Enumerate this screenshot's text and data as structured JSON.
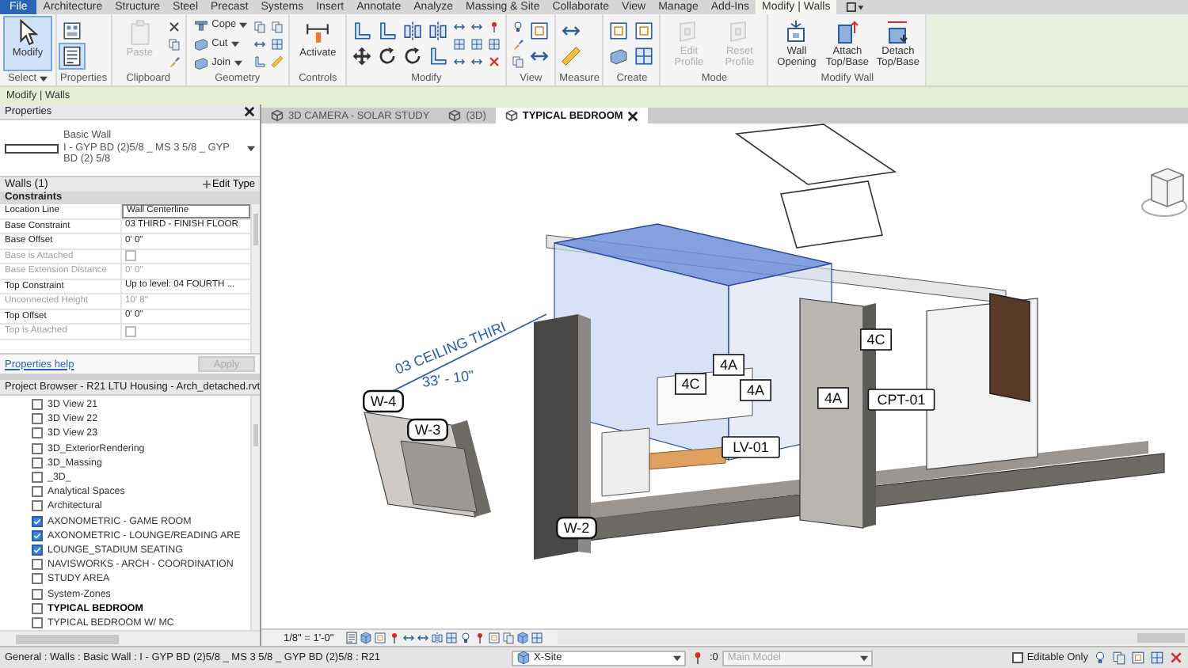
{
  "menu_tabs": [
    {
      "label": "File",
      "kind": "file",
      "selected": false
    },
    {
      "label": "Architecture",
      "kind": "tab",
      "selected": false
    },
    {
      "label": "Structure",
      "kind": "tab",
      "selected": false
    },
    {
      "label": "Steel",
      "kind": "tab",
      "selected": false
    },
    {
      "label": "Precast",
      "kind": "tab",
      "selected": false
    },
    {
      "label": "Systems",
      "kind": "tab",
      "selected": false
    },
    {
      "label": "Insert",
      "kind": "tab",
      "selected": false
    },
    {
      "label": "Annotate",
      "kind": "tab",
      "selected": false
    },
    {
      "label": "Analyze",
      "kind": "tab",
      "selected": false
    },
    {
      "label": "Massing & Site",
      "kind": "tab",
      "selected": false
    },
    {
      "label": "Collaborate",
      "kind": "tab",
      "selected": false
    },
    {
      "label": "View",
      "kind": "tab",
      "selected": false
    },
    {
      "label": "Manage",
      "kind": "tab",
      "selected": false
    },
    {
      "label": "Add-Ins",
      "kind": "tab",
      "selected": false
    },
    {
      "label": "Modify | Walls",
      "kind": "tab",
      "selected": true
    }
  ],
  "ribbon_panels": [
    {
      "title": "Select",
      "menu": true,
      "columns": [
        [
          {
            "kind": "large",
            "label": "Modify",
            "selected": true,
            "disabled": false
          }
        ]
      ]
    },
    {
      "title": "Properties",
      "menu": false,
      "columns": [
        [
          {
            "kind": "icon",
            "selected": false,
            "disabled": false
          },
          {
            "kind": "icon",
            "selected": true,
            "disabled": false
          }
        ]
      ]
    },
    {
      "title": "Clipboard",
      "menu": false,
      "columns": [
        [
          {
            "kind": "large",
            "label": "Paste",
            "selected": false,
            "disabled": true
          }
        ],
        [
          {
            "kind": "icon",
            "selected": false,
            "disabled": false
          },
          {
            "kind": "icon",
            "selected": false,
            "disabled": false
          },
          {
            "kind": "icon",
            "selected": false,
            "disabled": false
          }
        ]
      ]
    },
    {
      "title": "Geometry",
      "menu": false,
      "columns": [
        [
          {
            "kind": "small",
            "label": "Cope",
            "menu": true,
            "selected": false,
            "disabled": false
          },
          {
            "kind": "small",
            "label": "Cut",
            "menu": true,
            "selected": false,
            "disabled": false
          },
          {
            "kind": "small",
            "label": "Join",
            "menu": true,
            "selected": false,
            "disabled": false
          }
        ],
        [
          {
            "kind": "icon",
            "selected": false,
            "disabled": false
          },
          {
            "kind": "icon",
            "selected": false,
            "disabled": false
          },
          {
            "kind": "icon",
            "selected": false,
            "disabled": false
          }
        ],
        [
          {
            "kind": "icon",
            "selected": false,
            "disabled": false
          },
          {
            "kind": "icon",
            "selected": false,
            "disabled": false
          },
          {
            "kind": "icon",
            "selected": false,
            "disabled": false
          }
        ]
      ]
    },
    {
      "title": "Controls",
      "menu": false,
      "columns": [
        [
          {
            "kind": "large",
            "label": "Activate",
            "selected": false,
            "disabled": false
          }
        ]
      ]
    },
    {
      "title": "Modify",
      "menu": false,
      "columns": [
        [
          {
            "kind": "icon",
            "selected": false,
            "disabled": false
          },
          {
            "kind": "icon",
            "selected": false,
            "disabled": false
          }
        ],
        [
          {
            "kind": "icon",
            "selected": false,
            "disabled": false
          },
          {
            "kind": "icon",
            "selected": false,
            "disabled": false
          }
        ],
        [
          {
            "kind": "icon",
            "selected": false,
            "disabled": false
          },
          {
            "kind": "icon",
            "selected": false,
            "disabled": false
          }
        ],
        [
          {
            "kind": "icon",
            "selected": false,
            "disabled": false
          },
          {
            "kind": "icon",
            "selected": false,
            "disabled": false
          }
        ],
        [
          {
            "kind": "icon",
            "selected": false,
            "disabled": false
          },
          {
            "kind": "icon",
            "selected": false,
            "disabled": false
          },
          {
            "kind": "icon",
            "selected": false,
            "disabled": false
          }
        ],
        [
          {
            "kind": "icon",
            "selected": false,
            "disabled": false
          },
          {
            "kind": "icon",
            "selected": false,
            "disabled": false
          },
          {
            "kind": "icon",
            "selected": false,
            "disabled": false
          }
        ],
        [
          {
            "kind": "icon",
            "selected": false,
            "disabled": false
          },
          {
            "kind": "icon",
            "selected": false,
            "disabled": false
          },
          {
            "kind": "icon",
            "selected": false,
            "disabled": false
          }
        ]
      ]
    },
    {
      "title": "View",
      "menu": false,
      "columns": [
        [
          {
            "kind": "icon",
            "selected": false,
            "disabled": false
          },
          {
            "kind": "icon",
            "selected": false,
            "disabled": false
          },
          {
            "kind": "icon",
            "selected": false,
            "disabled": false
          }
        ],
        [
          {
            "kind": "icon",
            "selected": false,
            "disabled": false
          },
          {
            "kind": "icon",
            "selected": false,
            "disabled": false
          }
        ]
      ]
    },
    {
      "title": "Measure",
      "menu": false,
      "columns": [
        [
          {
            "kind": "icon",
            "selected": false,
            "disabled": false
          },
          {
            "kind": "icon",
            "selected": false,
            "disabled": false
          }
        ]
      ]
    },
    {
      "title": "Create",
      "menu": false,
      "columns": [
        [
          {
            "kind": "icon",
            "selected": false,
            "disabled": false
          },
          {
            "kind": "icon",
            "selected": false,
            "disabled": false
          }
        ],
        [
          {
            "kind": "icon",
            "selected": false,
            "disabled": false
          },
          {
            "kind": "icon",
            "selected": false,
            "disabled": false
          }
        ]
      ]
    },
    {
      "title": "Mode",
      "menu": false,
      "columns": [
        [
          {
            "kind": "large",
            "label": "Edit Profile",
            "selected": false,
            "disabled": true
          }
        ],
        [
          {
            "kind": "large",
            "label": "Reset Profile",
            "selected": false,
            "disabled": true
          }
        ]
      ]
    },
    {
      "title": "Modify Wall",
      "menu": false,
      "columns": [
        [
          {
            "kind": "large",
            "label": "Wall Opening",
            "selected": false,
            "disabled": false
          }
        ],
        [
          {
            "kind": "large",
            "label": "Attach Top/Base",
            "selected": false,
            "disabled": false
          }
        ],
        [
          {
            "kind": "large",
            "label": "Detach Top/Base",
            "selected": false,
            "disabled": false
          }
        ]
      ]
    }
  ],
  "context_bar": "Modify | Walls",
  "properties": {
    "title": "Properties",
    "family": "Basic Wall",
    "type": "I - GYP BD (2)5/8 _ MS 3 5/8 _ GYP BD (2) 5/8",
    "instances": "Walls (1)",
    "edit_type": "Edit Type",
    "section": "Constraints",
    "rows": [
      {
        "name": "Location Line",
        "kind": "text",
        "value": "Wall Centerline",
        "disabled": false
      },
      {
        "name": "Base Constraint",
        "kind": "text",
        "value": "03 THIRD - FINISH FLOOR",
        "disabled": false
      },
      {
        "name": "Base Offset",
        "kind": "text",
        "value": "0'  0\"",
        "disabled": false
      },
      {
        "name": "Base is Attached",
        "kind": "checkbox",
        "checked": false,
        "disabled": true
      },
      {
        "name": "Base Extension Distance",
        "kind": "text",
        "value": "0'  0\"",
        "disabled": true
      },
      {
        "name": "Top Constraint",
        "kind": "text",
        "value": "Up to level: 04 FOURTH ...",
        "disabled": false
      },
      {
        "name": "Unconnected Height",
        "kind": "text",
        "value": "10'  8\"",
        "disabled": true
      },
      {
        "name": "Top Offset",
        "kind": "text",
        "value": "0'  0\"",
        "disabled": false
      },
      {
        "name": "Top is Attached",
        "kind": "checkbox",
        "checked": false,
        "disabled": true
      }
    ],
    "help_link": "Properties help",
    "apply": {
      "label": "Apply",
      "disabled": true
    }
  },
  "project_browser": {
    "title": "Project Browser - R21 LTU Housing - Arch_detached.rvt",
    "items": [
      {
        "label": "3D View 21",
        "checked": false,
        "current": false
      },
      {
        "label": "3D View 22",
        "checked": false,
        "current": false
      },
      {
        "label": "3D View 23",
        "checked": false,
        "current": false
      },
      {
        "label": "3D_ExteriorRendering",
        "checked": false,
        "current": false
      },
      {
        "label": "3D_Massing",
        "checked": false,
        "current": false
      },
      {
        "label": "_3D_",
        "checked": false,
        "current": false
      },
      {
        "label": "Analytical Spaces",
        "checked": false,
        "current": false
      },
      {
        "label": "Architectural",
        "checked": false,
        "current": false
      },
      {
        "label": "AXONOMETRIC - GAME ROOM",
        "checked": true,
        "current": false
      },
      {
        "label": "AXONOMETRIC - LOUNGE/READING ARE",
        "checked": true,
        "current": false
      },
      {
        "label": "LOUNGE_STADIUM SEATING",
        "checked": true,
        "current": false
      },
      {
        "label": "NAVISWORKS - ARCH - COORDINATION",
        "checked": false,
        "current": false
      },
      {
        "label": "STUDY AREA",
        "checked": false,
        "current": false
      },
      {
        "label": "System-Zones",
        "checked": false,
        "current": false
      },
      {
        "label": "TYPICAL BEDROOM",
        "checked": false,
        "current": true
      },
      {
        "label": "TYPICAL BEDROOM W/ MC",
        "checked": false,
        "current": false
      }
    ]
  },
  "view_tabs": [
    {
      "label": "3D CAMERA - SOLAR STUDY",
      "selected": false
    },
    {
      "label": "(3D)",
      "selected": false
    },
    {
      "label": "TYPICAL BEDROOM",
      "selected": true
    }
  ],
  "view": {
    "level_name": "03 CEILING THIRI",
    "elevation": "33' - 10\"",
    "tags": [
      {
        "label": "W-4",
        "kind": "wall"
      },
      {
        "label": "W-3",
        "kind": "wall"
      },
      {
        "label": "W-2",
        "kind": "wall"
      },
      {
        "label": "4C",
        "kind": "door"
      },
      {
        "label": "4A",
        "kind": "door"
      },
      {
        "label": "4A",
        "kind": "door"
      },
      {
        "label": "4C",
        "kind": "door"
      },
      {
        "label": "4A",
        "kind": "door"
      },
      {
        "label": "CPT-01",
        "kind": "finish"
      },
      {
        "label": "LV-01",
        "kind": "finish"
      }
    ]
  },
  "view_bar": {
    "scale": "1/8\" = 1'-0\""
  },
  "status_bar": {
    "text": "General : Walls : Basic Wall : I - GYP BD (2)5/8 _ MS 3 5/8 _ GYP BD (2)5/8 : R21",
    "workset": "X-Site",
    "count": ":0",
    "design_option": {
      "value": "Main Model",
      "disabled": true
    },
    "editable_only": {
      "label": "Editable Only",
      "checked": false
    }
  }
}
